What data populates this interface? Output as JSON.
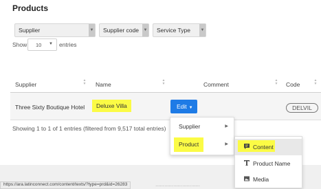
{
  "page": {
    "title": "Products"
  },
  "filters": {
    "supplier": "Supplier",
    "supplier_code": "Supplier code",
    "service_type": "Service Type"
  },
  "length": {
    "show": "Show",
    "value": "10",
    "entries": "entries"
  },
  "table": {
    "columns": [
      "Supplier",
      "Name",
      "Comment",
      "Code"
    ],
    "row": {
      "supplier": "Three Sixty Boutique Hotel",
      "name": "Deluxe Villa",
      "action": "Edit",
      "code": "DELVIL"
    },
    "info": "Showing 1 to 1 of 1 entries (filtered from 9,517 total entries)"
  },
  "edit_menu": {
    "items": [
      {
        "label": "Supplier",
        "has_submenu": true
      },
      {
        "label": "Product",
        "has_submenu": true,
        "highlighted": true
      }
    ]
  },
  "product_submenu": {
    "items": [
      {
        "label": "Content",
        "icon": "chat-bubble-icon",
        "active": true
      },
      {
        "label": "Product Name",
        "icon": "text-t-icon"
      },
      {
        "label": "Media",
        "icon": "image-icon"
      }
    ]
  },
  "status_bar": {
    "url": "https://ara.latinconnect.com/content/texts/?type=prd&id=26283"
  },
  "colors": {
    "primary": "#1e7be6",
    "highlight": "#fbfb45",
    "row_bg": "#f5f5f5",
    "menu_active": "#e8e8e8"
  }
}
